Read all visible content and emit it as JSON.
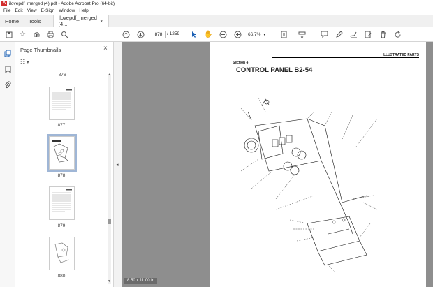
{
  "window": {
    "title": "ilovepdf_merged (4).pdf - Adobe Acrobat Pro (64-bit)"
  },
  "menu": [
    "File",
    "Edit",
    "View",
    "E-Sign",
    "Window",
    "Help"
  ],
  "tabs": {
    "home": "Home",
    "tools": "Tools",
    "doc": "ilovepdf_merged (4...",
    "close": "×"
  },
  "nav": {
    "page_current": "878",
    "page_total": "/ 1259",
    "zoom": "66.7%"
  },
  "panel": {
    "title": "Page Thumbnails",
    "close": "×",
    "thumbs": [
      {
        "label": "876"
      },
      {
        "label": "877"
      },
      {
        "label": "878"
      },
      {
        "label": "879"
      },
      {
        "label": "880"
      }
    ]
  },
  "page": {
    "header": "ILLUSTRATED PARTS",
    "section": "Section 4",
    "title": "CONTROL PANEL B2-54"
  },
  "status": {
    "size": "8.50 x 11.00 in"
  }
}
